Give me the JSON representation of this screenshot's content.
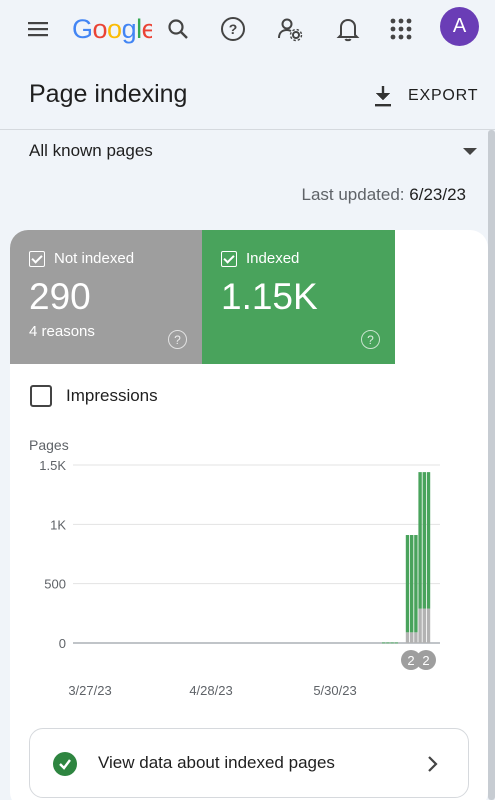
{
  "header": {
    "logo_text": "Google",
    "icons": [
      "menu-icon",
      "search-icon",
      "help-icon",
      "manage-users-icon",
      "notifications-icon",
      "apps-icon"
    ],
    "avatar_letter": "A",
    "avatar_color": "#6a3db6"
  },
  "page": {
    "title": "Page indexing",
    "export_label": "EXPORT"
  },
  "filter": {
    "selected": "All known pages"
  },
  "last_updated": {
    "label": "Last updated:",
    "value": "6/23/23"
  },
  "tiles": {
    "not_indexed": {
      "label": "Not indexed",
      "value": "290",
      "sub": "4 reasons",
      "color": "#9e9e9e",
      "checked": true
    },
    "indexed": {
      "label": "Indexed",
      "value": "1.15K",
      "color": "#49a35c",
      "checked": true
    }
  },
  "impressions": {
    "label": "Impressions",
    "checked": false
  },
  "chart_data": {
    "type": "bar",
    "stacked": true,
    "ylabel": "Pages",
    "ylim": [
      0,
      1500
    ],
    "yticks": [
      "0",
      "500",
      "1K",
      "1.5K"
    ],
    "xticks": [
      "3/27/23",
      "4/28/23",
      "5/30/23"
    ],
    "grid": true,
    "series": [
      {
        "name": "Indexed",
        "color": "#49a35c",
        "values": [
          5,
          5,
          5,
          5,
          820,
          820,
          820,
          1150,
          1150,
          1150
        ]
      },
      {
        "name": "Not indexed",
        "color": "#b3b3b3",
        "values": [
          0,
          0,
          0,
          0,
          90,
          90,
          90,
          290,
          290,
          290
        ]
      }
    ],
    "annotations": [
      "2",
      "2"
    ]
  },
  "view_button": {
    "label": "View data about indexed pages"
  }
}
